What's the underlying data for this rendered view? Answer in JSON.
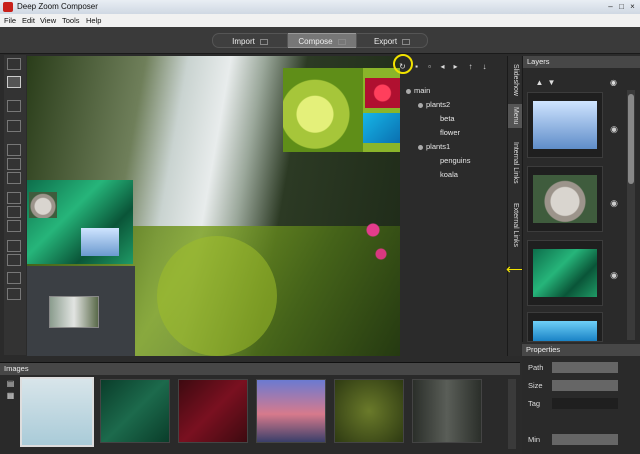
{
  "window": {
    "title": "Deep Zoom Composer",
    "min_icon": "minimize-icon",
    "max_icon": "maximize-icon",
    "close_icon": "close-icon"
  },
  "menu": [
    "File",
    "Edit",
    "View",
    "Tools",
    "Help"
  ],
  "mode_tabs": [
    {
      "label": "Import",
      "selected": false
    },
    {
      "label": "Compose",
      "selected": true
    },
    {
      "label": "Export",
      "selected": false
    }
  ],
  "tree": [
    {
      "label": "main",
      "level": 0,
      "bullet": true
    },
    {
      "label": "plants2",
      "level": 1,
      "bullet": true
    },
    {
      "label": "beta",
      "level": 2,
      "bullet": false
    },
    {
      "label": "flower",
      "level": 2,
      "bullet": false
    },
    {
      "label": "plants1",
      "level": 1,
      "bullet": true
    },
    {
      "label": "penguins",
      "level": 2,
      "bullet": false
    },
    {
      "label": "koala",
      "level": 2,
      "bullet": false
    }
  ],
  "side_tabs": [
    {
      "label": "Slideshow",
      "selected": false
    },
    {
      "label": "Menu",
      "selected": true
    },
    {
      "label": "Internal Links",
      "selected": false
    },
    {
      "label": "External Links",
      "selected": false
    }
  ],
  "layers": {
    "title": "Layers"
  },
  "properties": {
    "title": "Properties",
    "fields": [
      {
        "label": "Path",
        "value": ""
      },
      {
        "label": "Size",
        "value": ""
      },
      {
        "label": "Tag",
        "value": ""
      },
      {
        "label": "Min",
        "value": ""
      }
    ]
  },
  "images": {
    "title": "Images"
  },
  "accent_highlight": "#f2e300"
}
